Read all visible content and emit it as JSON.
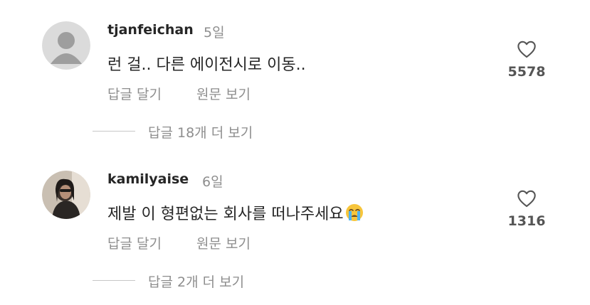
{
  "comments": [
    {
      "username": "tjanfeichan",
      "time": "5일",
      "text": "런 걸.. 다른 에이전시로 이동..",
      "reply_label": "답글 달기",
      "translate_label": "원문 보기",
      "likes": "5578",
      "view_replies": "답글 18개 더 보기",
      "avatar": "default-avatar-icon"
    },
    {
      "username": "kamilyaise",
      "time": "6일",
      "text": "제발 이 형편없는 회사를 떠나주세요",
      "emoji": "crying-face",
      "reply_label": "답글 달기",
      "translate_label": "원문 보기",
      "likes": "1316",
      "view_replies": "답글 2개 더 보기",
      "avatar": "profile-photo"
    }
  ],
  "colors": {
    "text": "#262626",
    "secondary": "#8e8e8e",
    "avatar_bg": "#dbdbdb",
    "avatar_fg": "#9e9e9e",
    "divider": "#c7c7c7"
  }
}
